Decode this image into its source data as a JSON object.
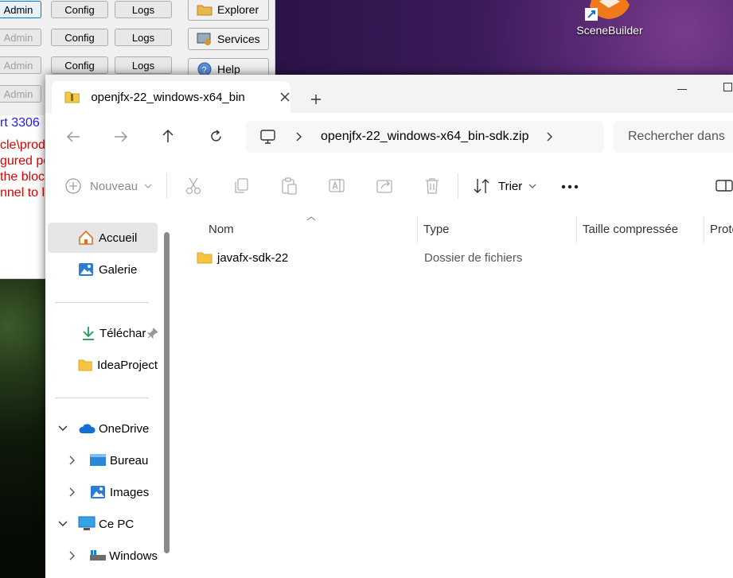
{
  "xampp": {
    "rows": [
      {
        "admin": "Admin",
        "config": "Config",
        "logs": "Logs",
        "admin_state": "selected"
      },
      {
        "admin": "Admin",
        "config": "Config",
        "logs": "Logs",
        "admin_state": "disabled"
      },
      {
        "admin": "Admin",
        "config": "Config",
        "logs": "Logs",
        "admin_state": "disabled"
      },
      {
        "admin": "Admin",
        "config": "",
        "logs": "",
        "admin_state": "disabled"
      }
    ],
    "side_buttons": {
      "explorer": "Explorer",
      "services": "Services",
      "help": "Help"
    },
    "log_lines": [
      {
        "text": "rt 3306",
        "color": "#1a1aff"
      },
      {
        "text": "",
        "color": "#000"
      },
      {
        "text": "cle\\prod",
        "color": "#e00000"
      },
      {
        "text": "gured po",
        "color": "#e00000"
      },
      {
        "text": " the bloc",
        "color": "#e00000"
      },
      {
        "text": "nnel to lis",
        "color": "#e00000"
      }
    ]
  },
  "desktop": {
    "shortcut_label": "SceneBuilder"
  },
  "explorer": {
    "tab_title": "openjfx-22_windows-x64_bin-",
    "address_path": "openjfx-22_windows-x64_bin-sdk.zip",
    "search_placeholder": "Rechercher dans",
    "toolbar": {
      "new_label": "Nouveau",
      "sort_label": "Trier"
    },
    "nav": {
      "home": "Accueil",
      "gallery": "Galerie",
      "downloads": "Téléchar",
      "ideaprojects": "IdeaProject",
      "onedrive": "OneDrive",
      "bureau": "Bureau",
      "images": "Images",
      "cepc": "Ce PC",
      "windows": "Windows"
    },
    "columns": {
      "name": "Nom",
      "type": "Type",
      "compressed": "Taille compressée",
      "protected": "Prote"
    },
    "files": [
      {
        "name": "javafx-sdk-22",
        "type": "Dossier de fichiers",
        "icon": "folder-icon"
      }
    ]
  }
}
